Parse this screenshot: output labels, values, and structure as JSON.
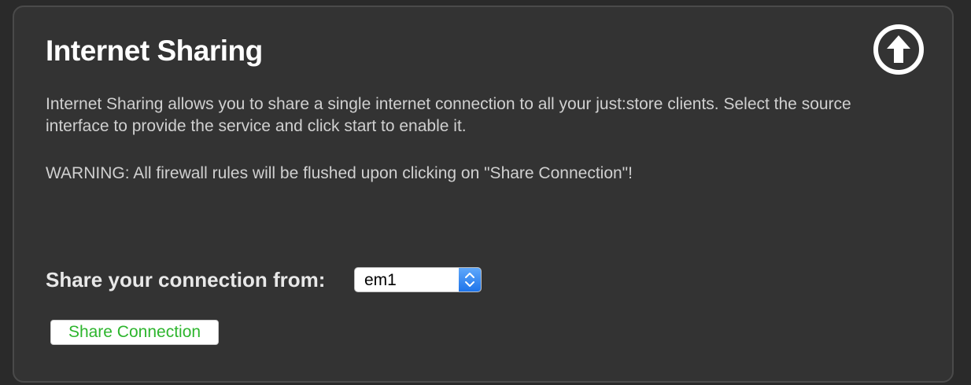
{
  "panel": {
    "title": "Internet Sharing",
    "description": "Internet Sharing allows you to share a single internet connection to all your just:store clients. Select the source interface to provide the service and click start to enable it.",
    "warning": "WARNING: All firewall rules will be flushed upon clicking on \"Share Connection\"!",
    "up_icon": "arrow-up-circle-icon"
  },
  "share": {
    "label": "Share your connection from:",
    "interface_selected": "em1",
    "button_label": "Share Connection",
    "button_text_color": "#2db52d"
  },
  "colors": {
    "background": "#2a2a2a",
    "panel": "#333333",
    "accent_blue": "#1e74ea"
  }
}
